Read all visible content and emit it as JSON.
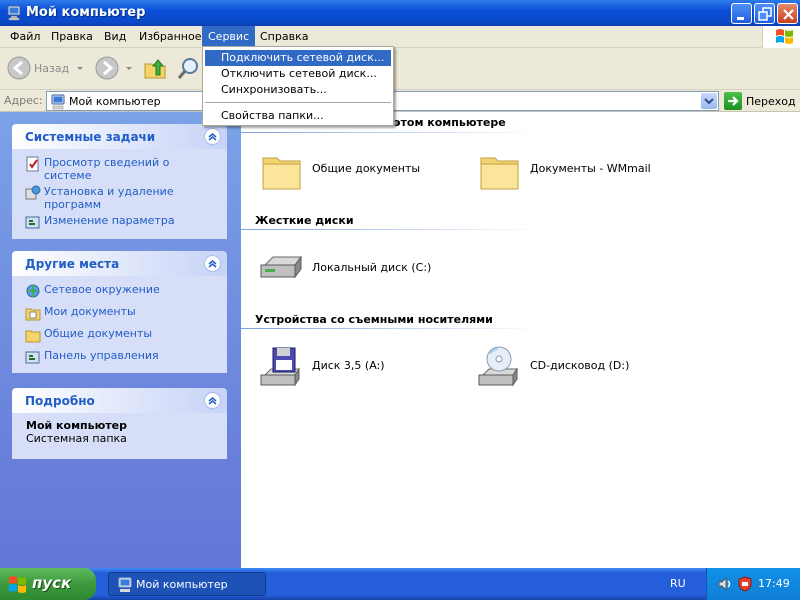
{
  "window": {
    "title": "Мой компьютер"
  },
  "menubar": {
    "items": [
      "Файл",
      "Правка",
      "Вид",
      "Избранное",
      "Сервис",
      "Справка"
    ],
    "active_index": 4
  },
  "dropdown": {
    "items": [
      "Подключить сетевой диск...",
      "Отключить сетевой диск...",
      "Синхронизовать...",
      "Свойства папки..."
    ],
    "highlighted_index": 0
  },
  "toolbar": {
    "back_label": "Назад"
  },
  "address": {
    "label": "Адрес:",
    "value": "Мой компьютер",
    "go_label": "Переход"
  },
  "sidebar": {
    "system_tasks": {
      "title": "Системные задачи",
      "items": [
        "Просмотр сведений о системе",
        "Установка и удаление программ",
        "Изменение параметра"
      ]
    },
    "other_places": {
      "title": "Другие места",
      "items": [
        "Сетевое окружение",
        "Мои документы",
        "Общие документы",
        "Панель управления"
      ]
    },
    "details": {
      "title": "Подробно",
      "name": "Мой компьютер",
      "type": "Системная папка"
    }
  },
  "content": {
    "sections": [
      {
        "title": "Файлы, хранящиеся на этом компьютере",
        "visible_tail": "этом компьютере",
        "items": [
          "Общие документы",
          "Документы - WMmail"
        ]
      },
      {
        "title": "Жесткие диски",
        "items": [
          "Локальный диск (C:)"
        ]
      },
      {
        "title": "Устройства со съемными носителями",
        "items": [
          "Диск 3,5 (A:)",
          "CD-дисковод (D:)"
        ]
      }
    ]
  },
  "taskbar": {
    "start_label": "пуск",
    "task_label": "Мой компьютер",
    "lang": "RU",
    "clock": "17:49"
  },
  "colors": {
    "title_blue": "#0a4fd8",
    "menu_highlight": "#316ac5",
    "sidebar_bg": "#6375d6",
    "panel_title": "#215dc6",
    "start_green": "#3c9a3c"
  }
}
